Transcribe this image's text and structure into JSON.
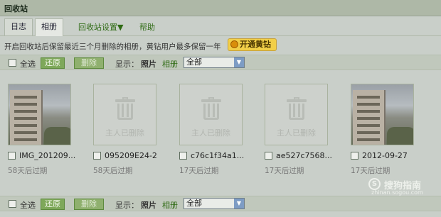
{
  "window": {
    "title": "回收站"
  },
  "tabs": [
    {
      "label": "日志",
      "active": false
    },
    {
      "label": "相册",
      "active": true
    }
  ],
  "menu": {
    "settings": "回收站设置",
    "settings_arrow": "▼",
    "help": "帮助"
  },
  "notice": {
    "text": "开启回收站后保留最近三个月删除的相册，黄钻用户最多保留一年",
    "button": "开通黄钻"
  },
  "toolbar": {
    "select_all": "全选",
    "restore": "还原",
    "delete": "删除",
    "display_label": "显示：",
    "photo": "照片",
    "album": "相册",
    "filter_value": "全部"
  },
  "photos": [
    {
      "name": "IMG_201209...",
      "expiry": "58天后过期",
      "deleted": false
    },
    {
      "name": "095209E24-2",
      "expiry": "58天后过期",
      "deleted": true,
      "deleted_text": "主人已删除"
    },
    {
      "name": "c76c1f34a1...",
      "expiry": "17天后过期",
      "deleted": true,
      "deleted_text": "主人已删除"
    },
    {
      "name": "ae527c7568...",
      "expiry": "17天后过期",
      "deleted": true,
      "deleted_text": "主人已删除"
    },
    {
      "name": "2012-09-27",
      "expiry": "17天后过期",
      "deleted": false
    }
  ],
  "watermark": {
    "brand": "搜狗指南",
    "url": "zhinan.sogou.com",
    "logo_glyph": "S"
  },
  "colors": {
    "accent_green": "#7ea85a",
    "link_green": "#2f6b14",
    "vip_yellow": "#f2cf48"
  }
}
